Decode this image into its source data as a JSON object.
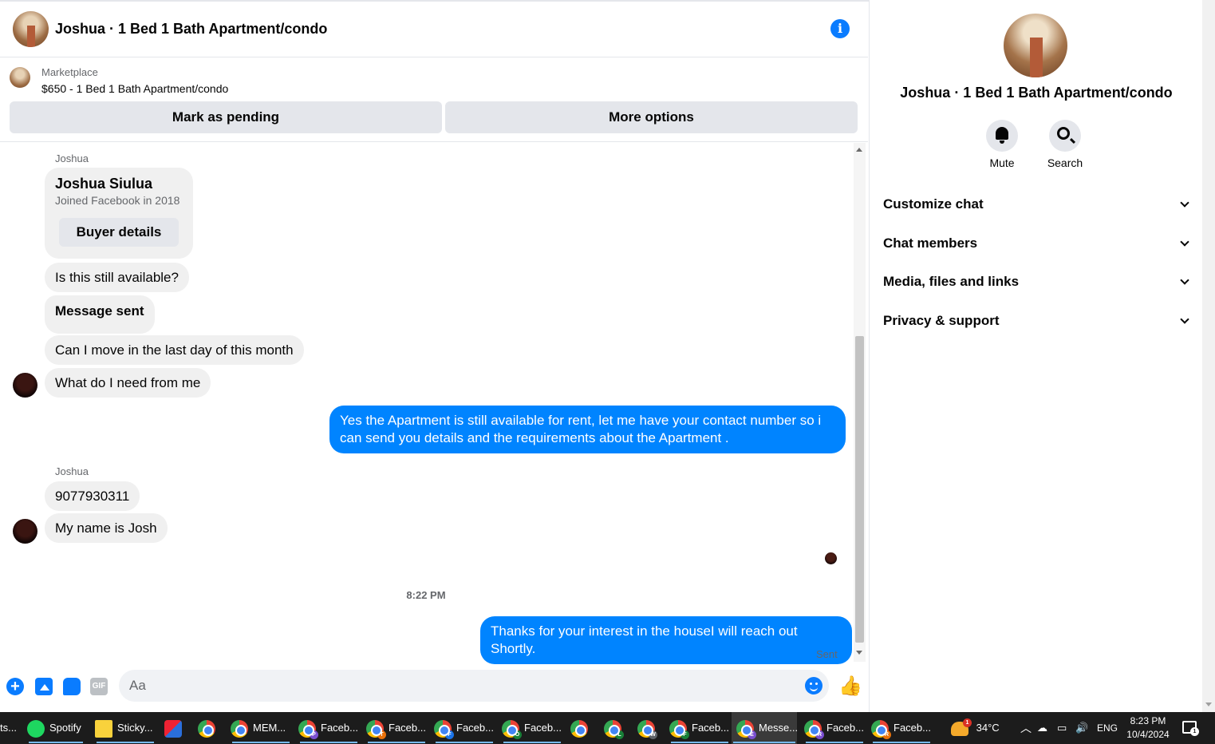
{
  "header": {
    "title": "Joshua · 1 Bed 1 Bath Apartment/condo"
  },
  "listing": {
    "kicker": "Marketplace",
    "title": "$650 - 1 Bed 1 Bath Apartment/condo",
    "pending_button": "Mark as pending",
    "more_button": "More options"
  },
  "messages": {
    "sender_1": "Joshua",
    "card": {
      "name": "Joshua Siulua",
      "subtitle": "Joined Facebook in 2018",
      "button": "Buyer details"
    },
    "m1": "Is this still available?",
    "m2": "Message sent",
    "m3": "Can I move in the last day of this month",
    "m4": "What do I need from me",
    "out1": "Yes the Apartment is still available for rent, let me have your contact number so i can send you details and the requirements about the Apartment .",
    "sender_2": "Joshua",
    "m5": "9077930311",
    "m6": "My name is Josh",
    "time": "8:22 PM",
    "out2": "Thanks for your interest in the houseI will reach out Shortly.",
    "status": "Sent"
  },
  "composer": {
    "placeholder": "Aa",
    "gif": "GIF"
  },
  "panel": {
    "name": "Joshua · 1 Bed 1 Bath Apartment/condo",
    "mute": "Mute",
    "search": "Search",
    "sections": [
      "Customize chat",
      "Chat members",
      "Media, files and links",
      "Privacy & support"
    ]
  },
  "taskbar": {
    "items": [
      "ts...",
      "Spotify",
      "Sticky...",
      "MEM...",
      "Faceb...",
      "Faceb...",
      "Faceb...",
      "Faceb...",
      "Faceb...",
      "Messe...",
      "Faceb...",
      "Faceb..."
    ],
    "badges": [
      "P",
      "T",
      "F",
      "O",
      "L",
      "W",
      "F",
      "E",
      "R",
      "R"
    ],
    "weather": "34°C",
    "weather_badge": "1",
    "lang": "ENG",
    "time": "8:23 PM",
    "date": "10/4/2024",
    "notif_count": "1"
  }
}
